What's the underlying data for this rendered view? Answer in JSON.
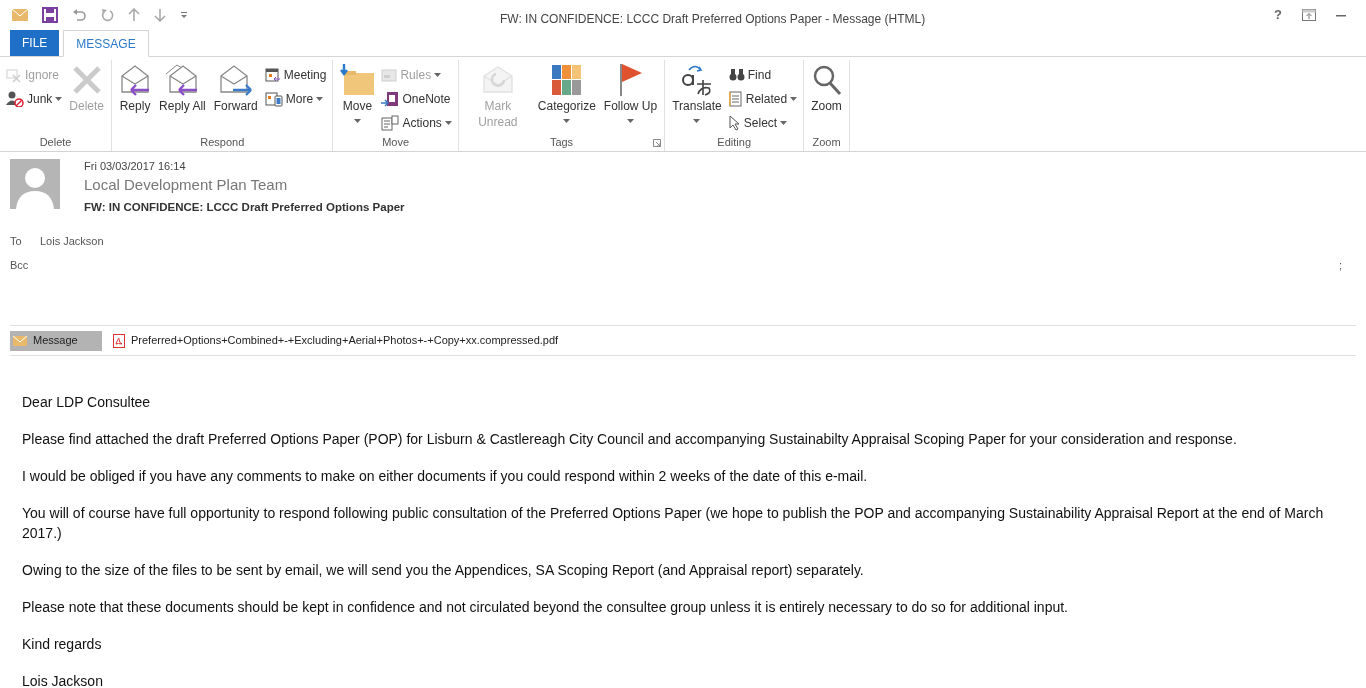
{
  "window": {
    "title": "FW: IN CONFIDENCE: LCCC Draft Preferred Options Paper - Message (HTML)",
    "controls": [
      "?"
    ]
  },
  "tabs": [
    {
      "label": "FILE",
      "kind": "file",
      "selected": false
    },
    {
      "label": "MESSAGE",
      "kind": "tab",
      "selected": true
    }
  ],
  "ribbon": {
    "groups": [
      {
        "label": "Delete",
        "launcher": false,
        "items": [
          {
            "label": "Ignore",
            "kind": "small",
            "disabled": true,
            "dropdown": false
          },
          {
            "label": "Junk",
            "kind": "small",
            "disabled": false,
            "dropdown": true
          },
          {
            "label": "Delete",
            "kind": "large",
            "disabled": true,
            "dropdown": false
          }
        ]
      },
      {
        "label": "Respond",
        "launcher": false,
        "items": [
          {
            "label": "Reply",
            "kind": "large",
            "disabled": false,
            "dropdown": false
          },
          {
            "label": "Reply All",
            "kind": "large",
            "disabled": false,
            "dropdown": false
          },
          {
            "label": "Forward",
            "kind": "large",
            "disabled": false,
            "dropdown": false
          },
          {
            "label": "Meeting",
            "kind": "small",
            "disabled": false,
            "dropdown": false
          },
          {
            "label": "More",
            "kind": "small",
            "disabled": false,
            "dropdown": true
          }
        ]
      },
      {
        "label": "Move",
        "launcher": false,
        "items": [
          {
            "label": "Move",
            "kind": "large",
            "disabled": false,
            "dropdown": true
          },
          {
            "label": "Rules",
            "kind": "small",
            "disabled": true,
            "dropdown": true
          },
          {
            "label": "OneNote",
            "kind": "small",
            "disabled": false,
            "dropdown": false
          },
          {
            "label": "Actions",
            "kind": "small",
            "disabled": false,
            "dropdown": true
          }
        ]
      },
      {
        "label": "Tags",
        "launcher": true,
        "items": [
          {
            "label": "Mark Unread",
            "kind": "large",
            "disabled": true,
            "dropdown": false
          },
          {
            "label": "Categorize",
            "kind": "large",
            "disabled": false,
            "dropdown": true
          },
          {
            "label": "Follow Up",
            "kind": "large",
            "disabled": false,
            "dropdown": true
          }
        ]
      },
      {
        "label": "Editing",
        "launcher": false,
        "items": [
          {
            "label": "Translate",
            "kind": "large",
            "disabled": false,
            "dropdown": true
          },
          {
            "label": "Find",
            "kind": "small",
            "disabled": false,
            "dropdown": false
          },
          {
            "label": "Related",
            "kind": "small",
            "disabled": false,
            "dropdown": true
          },
          {
            "label": "Select",
            "kind": "small",
            "disabled": false,
            "dropdown": true
          }
        ]
      },
      {
        "label": "Zoom",
        "launcher": false,
        "items": [
          {
            "label": "Zoom",
            "kind": "large",
            "disabled": false,
            "dropdown": false
          }
        ]
      }
    ]
  },
  "header": {
    "date": "Fri 03/03/2017 16:14",
    "sender": "Local Development Plan Team",
    "subject": "FW: IN CONFIDENCE: LCCC Draft Preferred Options Paper",
    "fields": [
      {
        "label": "To",
        "value": "Lois Jackson"
      },
      {
        "label": "Bcc",
        "value": ";"
      }
    ]
  },
  "attachments": [
    {
      "label": "Message",
      "kind": "message",
      "selected": true
    },
    {
      "label": "Preferred+Options+Combined+-+Excluding+Aerial+Photos+-+Copy+xx.compressed.pdf",
      "kind": "pdf",
      "selected": false
    }
  ],
  "body": [
    "Dear LDP Consultee",
    "Please find attached the draft Preferred Options Paper  (POP) for Lisburn & Castlereagh City Council and accompanying Sustainabilty Appraisal Scoping Paper for your consideration and response.",
    "I would be obliged if you have any comments to make on either documents if you could respond within 2 weeks of the date of this e-mail.",
    "You will of course have full opportunity to respond following public consultation of the Preferred Options Paper (we hope to publish the POP and accompanying Sustainability Appraisal Report at the end of March 2017.)",
    "Owing to the size of the files to be sent by email, we will send you the Appendices, SA Scoping Report (and Appraisal report) separately.",
    "Please note that these documents should be kept in confidence and not circulated beyond the consultee group unless it is entirely necessary to do so for additional input.",
    "Kind regards",
    "Lois Jackson"
  ]
}
